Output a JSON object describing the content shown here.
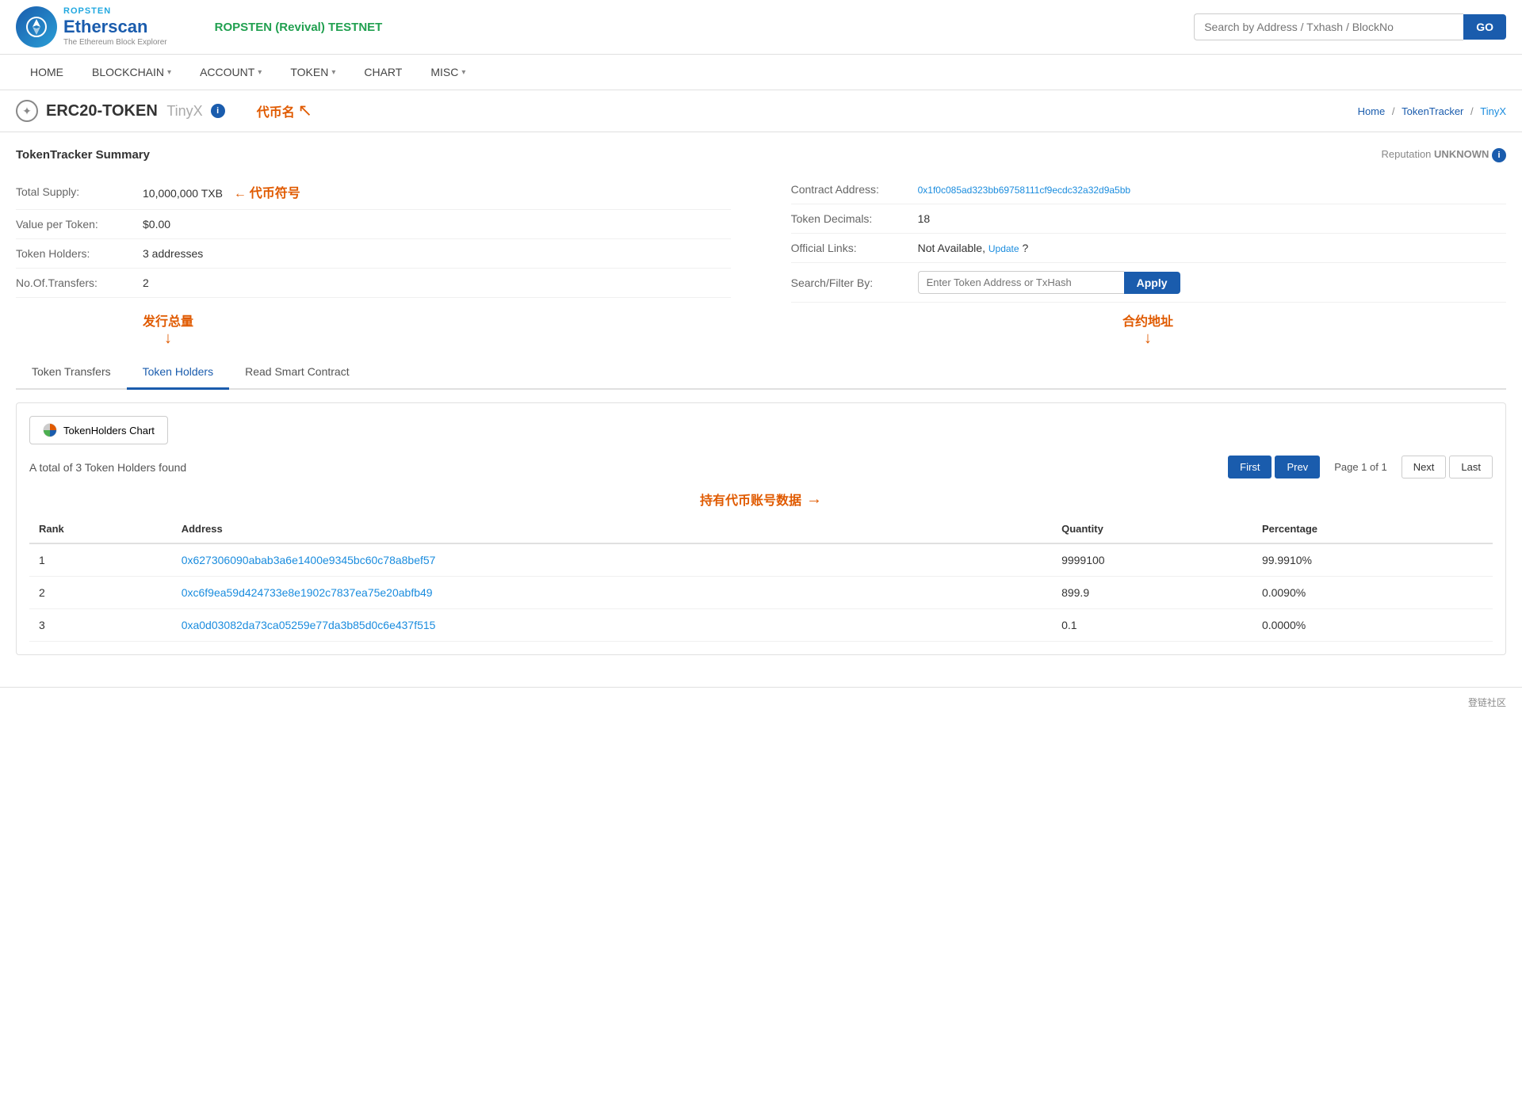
{
  "header": {
    "network": "ROPSTEN (Revival) TESTNET",
    "logo_ropsten": "ROPSTEN",
    "logo_name": "Etherscan",
    "logo_tagline": "The Ethereum Block Explorer",
    "search_placeholder": "Search by Address / Txhash / BlockNo",
    "search_btn": "GO"
  },
  "nav": {
    "items": [
      {
        "label": "HOME",
        "hasDropdown": false
      },
      {
        "label": "BLOCKCHAIN",
        "hasDropdown": true
      },
      {
        "label": "ACCOUNT",
        "hasDropdown": true
      },
      {
        "label": "TOKEN",
        "hasDropdown": true
      },
      {
        "label": "CHART",
        "hasDropdown": false
      },
      {
        "label": "MISC",
        "hasDropdown": true
      }
    ]
  },
  "breadcrumb": {
    "home": "Home",
    "token_tracker": "TokenTracker",
    "current": "TinyX"
  },
  "page": {
    "title": "ERC20-TOKEN",
    "token_name": "TinyX",
    "reputation_label": "Reputation",
    "reputation_value": "UNKNOWN"
  },
  "annotations": {
    "coin_name": "代币名",
    "total_supply_label": "发行总量",
    "coin_symbol": "代币符号",
    "contract_address_label": "合约地址",
    "holder_data": "持有代币账号数据"
  },
  "summary": {
    "title": "TokenTracker Summary",
    "total_supply_label": "Total Supply:",
    "total_supply_value": "10,000,000 TXB",
    "value_per_token_label": "Value per Token:",
    "value_per_token_value": "$0.00",
    "token_holders_label": "Token Holders:",
    "token_holders_value": "3 addresses",
    "no_transfers_label": "No.Of.Transfers:",
    "no_transfers_value": "2",
    "contract_address_label": "Contract Address:",
    "contract_address_value": "0x1f0c085ad323bb69758111cf9ecdc32a32d9a5bb",
    "token_decimals_label": "Token Decimals:",
    "token_decimals_value": "18",
    "official_links_label": "Official Links:",
    "official_links_value": "Not Available,",
    "official_links_update": "Update",
    "official_links_suffix": "?",
    "search_filter_label": "Search/Filter By:",
    "filter_placeholder": "Enter Token Address or TxHash",
    "apply_btn": "Apply"
  },
  "tabs": [
    {
      "label": "Token Transfers",
      "active": false
    },
    {
      "label": "Token Holders",
      "active": true
    },
    {
      "label": "Read Smart Contract",
      "active": false
    }
  ],
  "table_section": {
    "chart_btn": "TokenHolders Chart",
    "result_count": "A total of 3 Token Holders found",
    "pagination": {
      "first": "First",
      "prev": "Prev",
      "page_info": "Page 1 of 1",
      "next": "Next",
      "last": "Last"
    },
    "columns": [
      "Rank",
      "Address",
      "Quantity",
      "Percentage"
    ],
    "rows": [
      {
        "rank": "1",
        "address": "0x627306090abab3a6e1400e9345bc60c78a8bef57",
        "quantity": "9999100",
        "percentage": "99.9910%"
      },
      {
        "rank": "2",
        "address": "0xc6f9ea59d424733e8e1902c7837ea75e20abfb49",
        "quantity": "899.9",
        "percentage": "0.0090%"
      },
      {
        "rank": "3",
        "address": "0xa0d03082da73ca05259e77da3b85d0c6e437f515",
        "quantity": "0.1",
        "percentage": "0.0000%"
      }
    ]
  },
  "footer": {
    "note": "登链社区"
  }
}
